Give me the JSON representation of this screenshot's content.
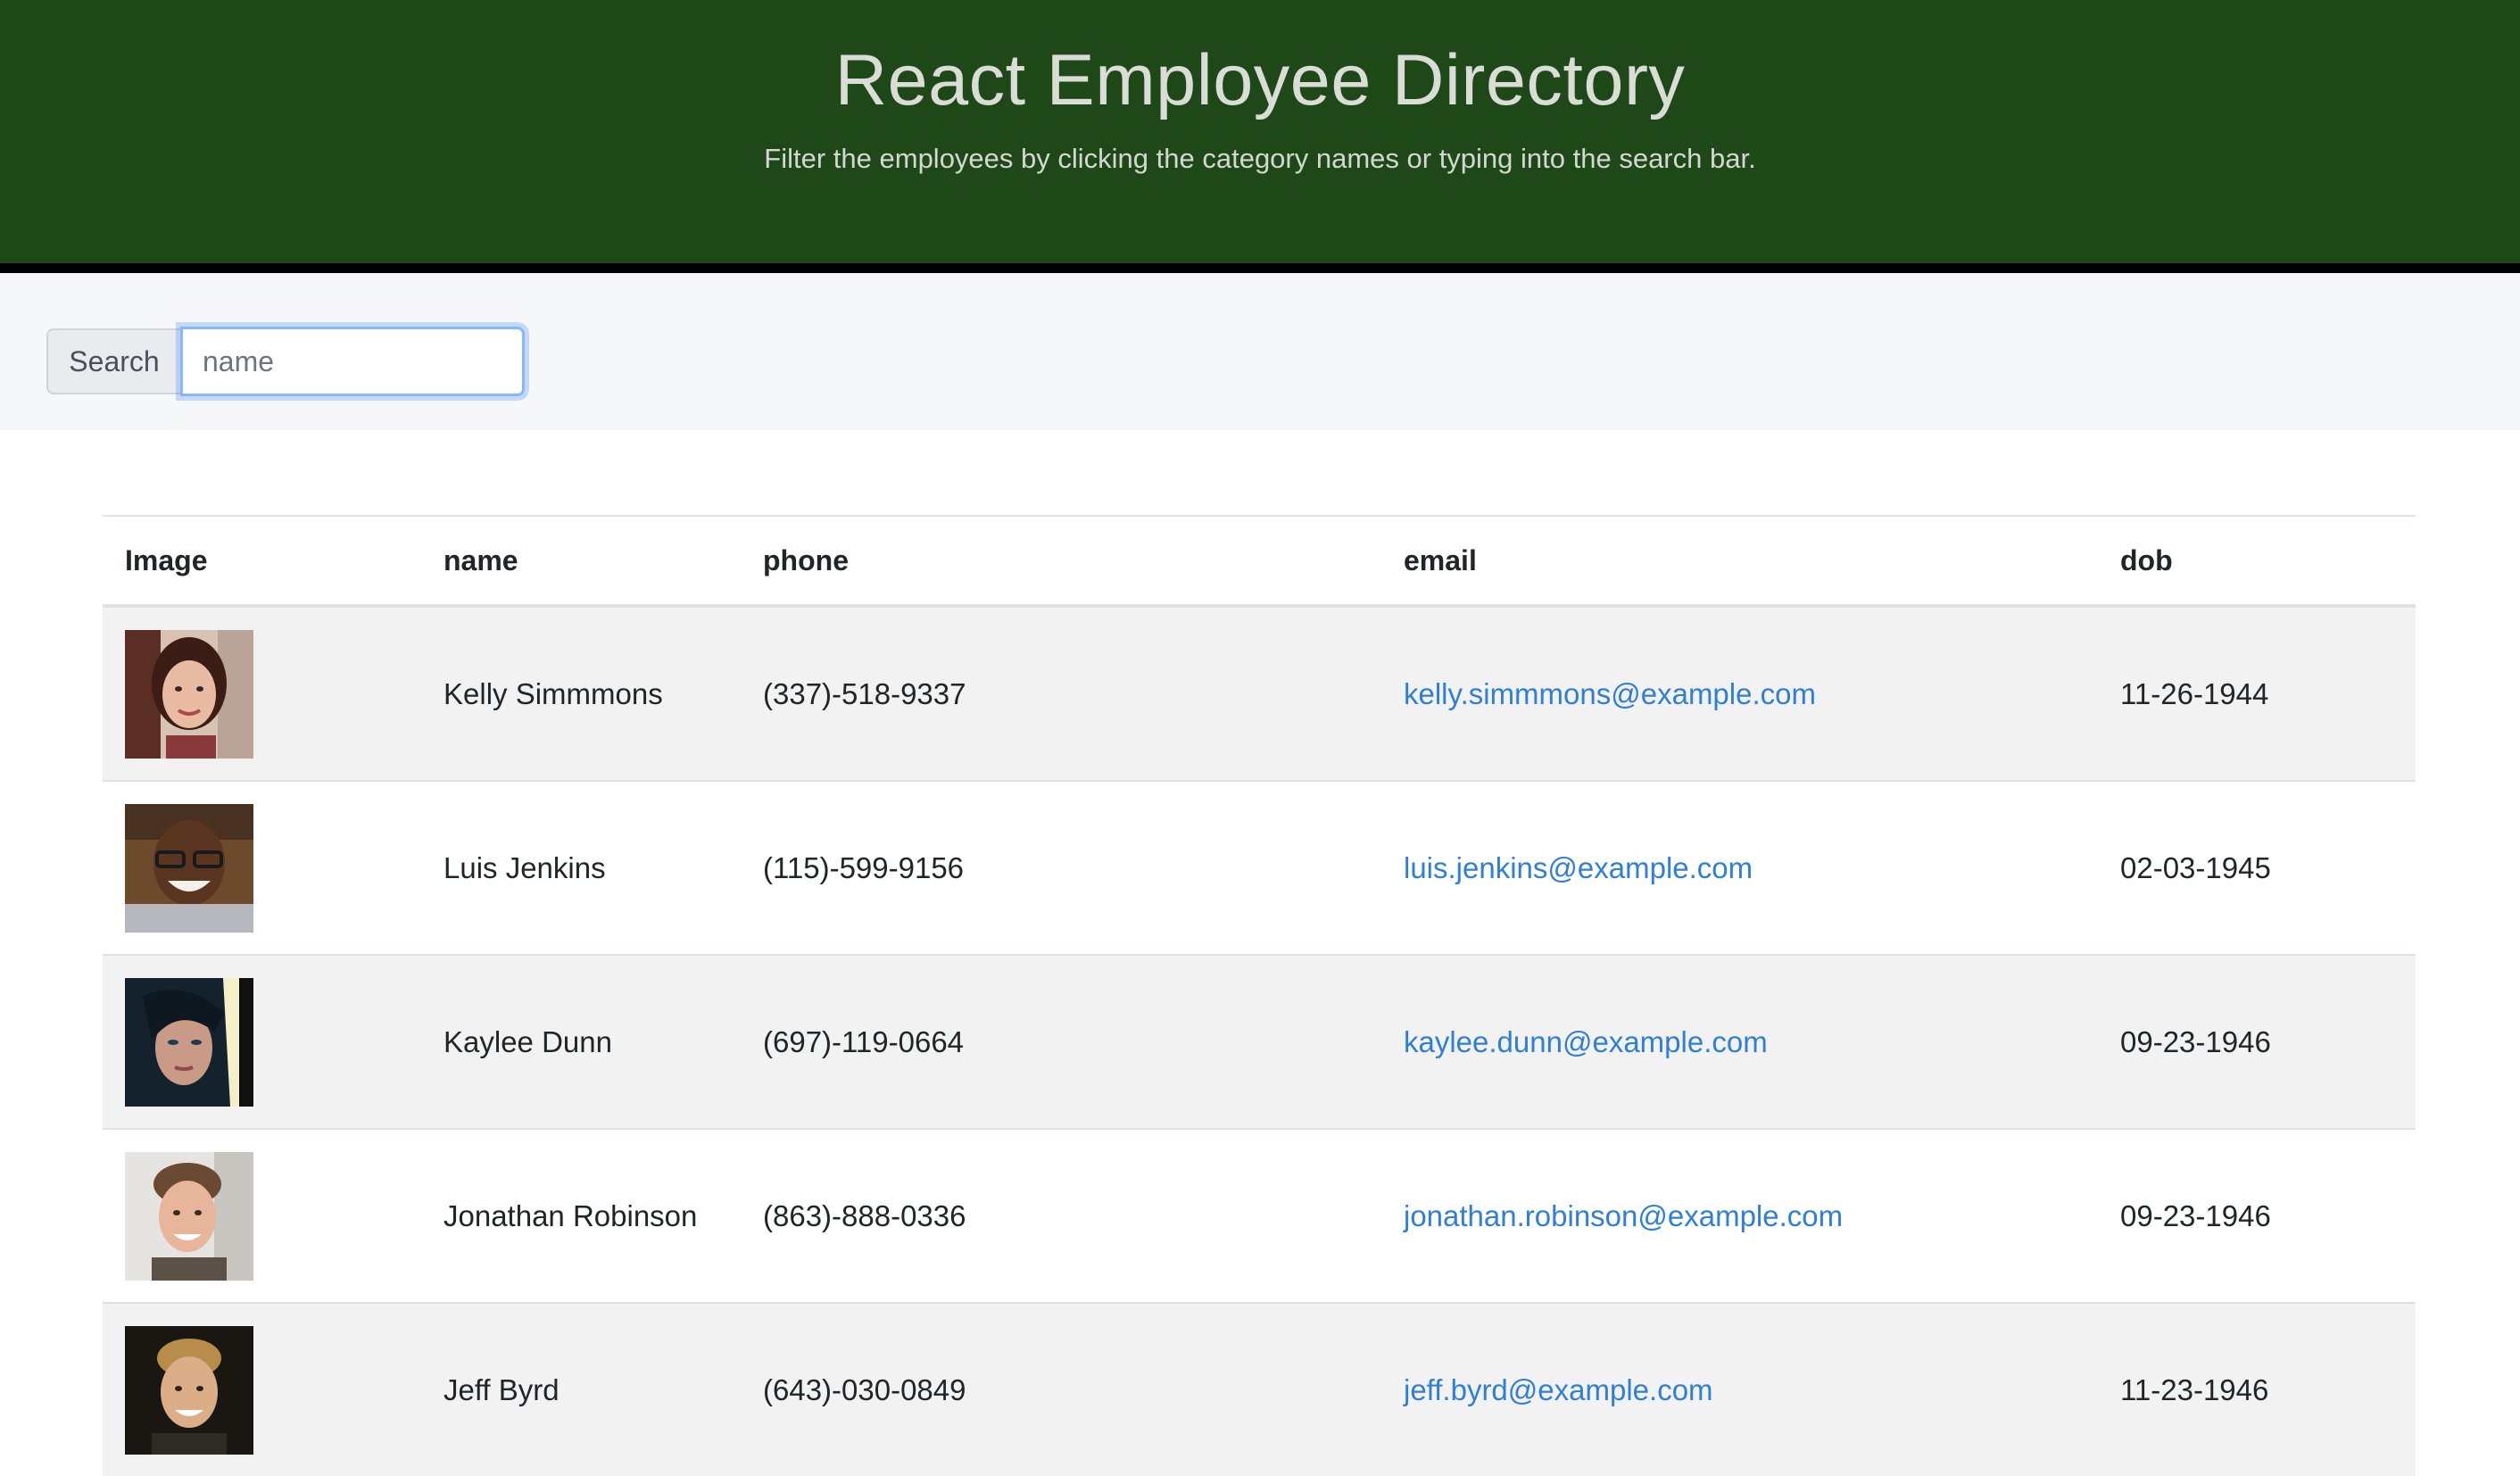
{
  "header": {
    "title": "React Employee Directory",
    "subtitle": "Filter the employees by clicking the category names or typing into the search bar."
  },
  "search": {
    "label": "Search",
    "placeholder": "name",
    "value": ""
  },
  "table": {
    "columns": [
      "Image",
      "name",
      "phone",
      "email",
      "dob"
    ],
    "rows": [
      {
        "name": "Kelly Simmmons",
        "phone": "(337)-518-9337",
        "email": "kelly.simmmons@example.com",
        "dob": "11-26-1944"
      },
      {
        "name": "Luis Jenkins",
        "phone": "(115)-599-9156",
        "email": "luis.jenkins@example.com",
        "dob": "02-03-1945"
      },
      {
        "name": "Kaylee Dunn",
        "phone": "(697)-119-0664",
        "email": "kaylee.dunn@example.com",
        "dob": "09-23-1946"
      },
      {
        "name": "Jonathan Robinson",
        "phone": "(863)-888-0336",
        "email": "jonathan.robinson@example.com",
        "dob": "09-23-1946"
      },
      {
        "name": "Jeff Byrd",
        "phone": "(643)-030-0849",
        "email": "jeff.byrd@example.com",
        "dob": "11-23-1946"
      }
    ]
  },
  "colors": {
    "header_bg": "#1f4818",
    "link": "#2f7fd6",
    "stripe": "#f2f2f2"
  }
}
